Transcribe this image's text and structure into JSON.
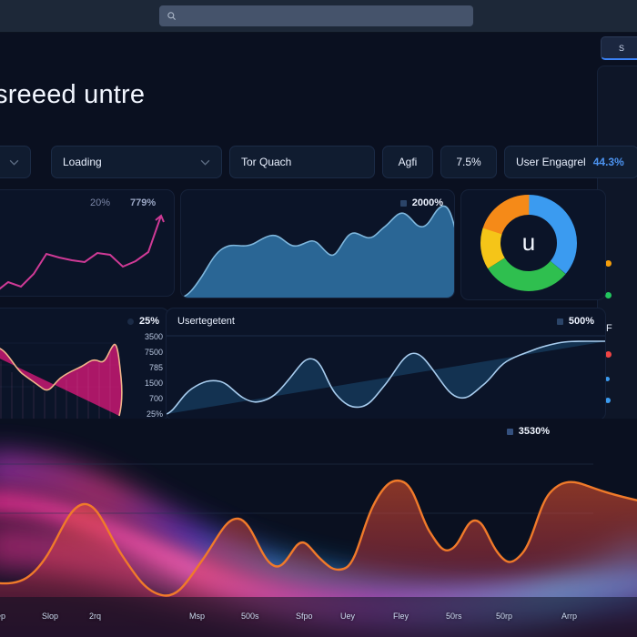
{
  "search": {
    "placeholder": "",
    "value": "",
    "icon": "search-icon"
  },
  "header": {
    "title": "sreeed untre"
  },
  "side_panel": {
    "tab_label": "S",
    "section_title": "F",
    "items": [
      {
        "label": "",
        "color": "#f59e0b"
      },
      {
        "label": "",
        "color": "#22c55e"
      },
      {
        "label": "",
        "color": "#ef4444"
      },
      {
        "label": "",
        "color": "#3b9bf0"
      },
      {
        "label": "",
        "color": "#3b9bf0"
      },
      {
        "label": "",
        "color": "#3b9bf0"
      }
    ]
  },
  "filters": [
    {
      "name": "chevron-chip",
      "label": "",
      "chevron": true,
      "x": 0,
      "w": 34
    },
    {
      "name": "status-select",
      "label": "Loading",
      "chevron": true,
      "x": 56,
      "w": 188
    },
    {
      "name": "name-chip",
      "label": "Tor Quach",
      "chevron": false,
      "x": 252,
      "w": 160
    },
    {
      "name": "agfi-chip",
      "label": "Agfi",
      "chevron": false,
      "x": 420,
      "w": 56
    },
    {
      "name": "rate-chip",
      "label": "7.5%",
      "chevron": false,
      "x": 484,
      "w": 62
    },
    {
      "name": "engagement-chip",
      "label": "User Engagrel",
      "accent": "44.3%",
      "chevron": false,
      "x": 554,
      "w": 148
    }
  ],
  "cards": {
    "trend_line": {
      "metric_a": "20%",
      "metric_b": "779%",
      "color": "#cf3a96"
    },
    "volume_area": {
      "metric": "2000%",
      "color": "#3c7fb0"
    },
    "donut": {
      "center_label": "u",
      "segments": [
        {
          "label": "",
          "value": 36,
          "color": "#3b9bf0"
        },
        {
          "label": "",
          "value": 30,
          "color": "#2fbf4f"
        },
        {
          "label": "",
          "value": 14,
          "color": "#f5c518"
        },
        {
          "label": "",
          "value": 20,
          "color": "#f58a18"
        }
      ]
    },
    "magenta_area": {
      "metric": "25%",
      "color": "#c2186f",
      "ticks": [
        "3500",
        "7500",
        "785",
        "1500",
        "700",
        "25%"
      ]
    },
    "engagement_wave": {
      "title": "Usertegetent",
      "metric": "500%",
      "color": "#7fb6e8"
    }
  },
  "hero": {
    "metric": "3530%",
    "line_color": "#f07a2a",
    "x_labels": [
      "ep",
      "Slop",
      "2rq",
      "Msp",
      "500s",
      "Sfpo",
      "Uey",
      "Fley",
      "50rs",
      "50rp",
      "Arrp"
    ]
  },
  "chart_data": [
    {
      "type": "line",
      "name": "trend_line",
      "title": "",
      "values": [
        18,
        14,
        22,
        17,
        26,
        44,
        40,
        38,
        36,
        45,
        43,
        34,
        38,
        46,
        92
      ],
      "ylim": [
        0,
        100
      ],
      "labels": [
        "20%",
        "779%"
      ],
      "color": "#cf3a96"
    },
    {
      "type": "area",
      "name": "volume_area",
      "title": "",
      "values": [
        2,
        6,
        20,
        44,
        50,
        47,
        57,
        60,
        52,
        48,
        57,
        46,
        38,
        52,
        62,
        57,
        60,
        55,
        78,
        86,
        72,
        76,
        70,
        92,
        86,
        66,
        52,
        48
      ],
      "ylim": [
        0,
        100
      ],
      "labels": [
        "2000%"
      ],
      "color": "#3c7fb0"
    },
    {
      "type": "pie",
      "name": "donut",
      "title": "u",
      "categories": [
        "",
        "",
        "",
        ""
      ],
      "values": [
        36,
        30,
        14,
        20
      ],
      "colors": [
        "#3b9bf0",
        "#2fbf4f",
        "#f5c518",
        "#f58a18"
      ]
    },
    {
      "type": "area",
      "name": "magenta_area",
      "title": "",
      "values": [
        72,
        78,
        70,
        52,
        46,
        42,
        30,
        22,
        34,
        40,
        44,
        50,
        62,
        58,
        66,
        82,
        74,
        50,
        22,
        8
      ],
      "ylim": [
        0,
        100
      ],
      "ytick_labels": [
        "3500",
        "7500",
        "785",
        "1500",
        "700",
        "25%"
      ],
      "labels": [
        "25%"
      ],
      "color": "#c2186f"
    },
    {
      "type": "area",
      "name": "engagement_wave",
      "title": "Usertegetent",
      "values": [
        6,
        18,
        32,
        38,
        30,
        24,
        26,
        30,
        40,
        70,
        62,
        38,
        26,
        20,
        24,
        30,
        52,
        76,
        70,
        52,
        40,
        44,
        58,
        74,
        82,
        86
      ],
      "ylim": [
        0,
        100
      ],
      "labels": [
        "500%"
      ],
      "color": "#7fb6e8"
    },
    {
      "type": "line",
      "name": "hero_chart",
      "title": "",
      "values": [
        10,
        8,
        24,
        52,
        46,
        26,
        14,
        10,
        20,
        48,
        40,
        28,
        34,
        26,
        18,
        22,
        62,
        78,
        66,
        48,
        42,
        58,
        46,
        34,
        40,
        72,
        80,
        70
      ],
      "ylim": [
        0,
        100
      ],
      "x_labels": [
        "ep",
        "Slop",
        "2rq",
        "Msp",
        "500s",
        "Sfpo",
        "Uey",
        "Fley",
        "50rs",
        "50rp",
        "Arrp"
      ],
      "labels": [
        "3530%"
      ],
      "color": "#f07a2a"
    }
  ]
}
